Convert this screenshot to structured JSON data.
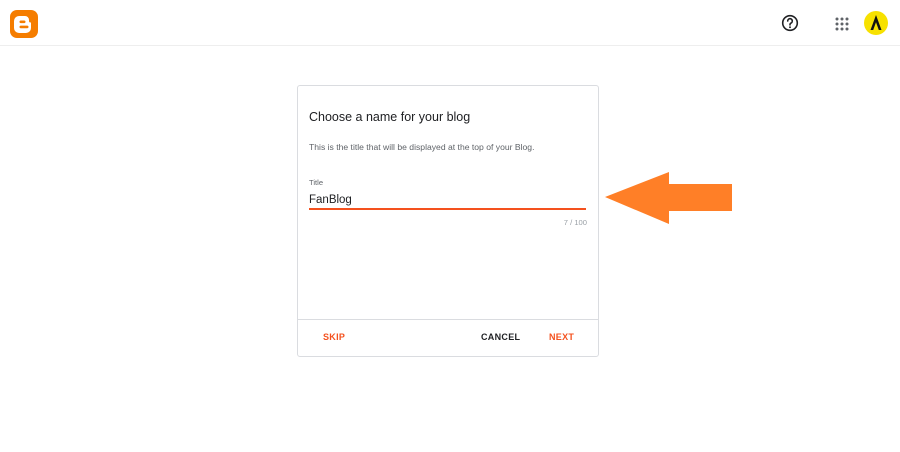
{
  "header": {
    "logo_icon": "blogger-logo-icon",
    "help_icon": "help-circle-icon",
    "apps_icon": "apps-grid-icon",
    "avatar_icon": "user-avatar-icon"
  },
  "dialog": {
    "title": "Choose a name for your blog",
    "description": "This is the title that will be displayed at the top of your Blog.",
    "field_label": "Title",
    "input_value": "FanBlog",
    "counter": "7 / 100",
    "skip_label": "SKIP",
    "cancel_label": "CANCEL",
    "next_label": "NEXT"
  },
  "annotation": {
    "arrow_icon": "pointer-arrow-icon",
    "arrow_color": "#ff7f27"
  },
  "colors": {
    "brand": "#f57d00",
    "accent": "#f4511e"
  }
}
